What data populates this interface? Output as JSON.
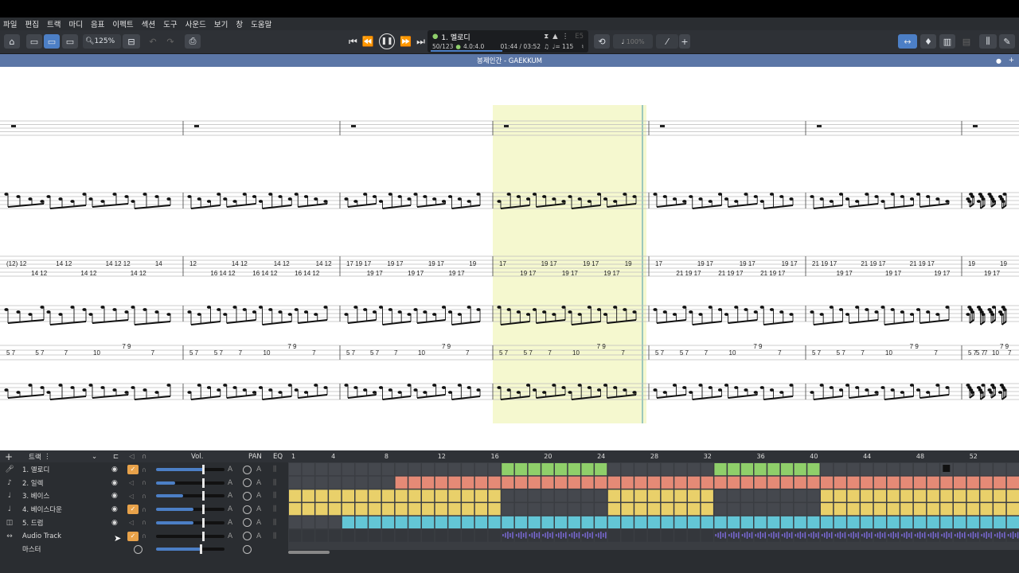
{
  "menu": [
    "파일",
    "편집",
    "트랙",
    "마디",
    "음표",
    "이펙트",
    "섹션",
    "도구",
    "사운드",
    "보기",
    "창",
    "도움말"
  ],
  "toolbar": {
    "zoom_value": "125%",
    "zoom_arrows": "⌃⌄"
  },
  "lcd": {
    "track_name": "1. 멜로디",
    "bar_position": "50/123",
    "time_signature": "4.0:4.0",
    "time": "01:44 / 03:52",
    "tempo": "♩= 115",
    "key": "E5",
    "speed": "100%"
  },
  "score": {
    "title": "봉제인간 - GAEKKUM"
  },
  "mixer": {
    "header_label": "트랙",
    "vol_label": "Vol.",
    "pan_label": "PAN",
    "eq_label": "EQ",
    "auto_label": "A",
    "ruler": [
      "1",
      "4",
      "8",
      "12",
      "16",
      "20",
      "24",
      "28",
      "32",
      "36",
      "40",
      "44",
      "48",
      "52"
    ],
    "tracks": [
      {
        "name": "1. 멜로디",
        "icon": "mic-icon",
        "solo": true,
        "vol": 0.7,
        "color": "#8fcf6a"
      },
      {
        "name": "2. 일렉",
        "icon": "guitar-icon",
        "solo": false,
        "vol": 0.28,
        "color": "#e58a76"
      },
      {
        "name": "3. 베이스",
        "icon": "bass-icon",
        "solo": false,
        "vol": 0.4,
        "color": "#e9d06a"
      },
      {
        "name": "4. 베이스다운",
        "icon": "bass-icon",
        "solo": true,
        "vol": 0.55,
        "color": "#e9d06a"
      },
      {
        "name": "5. 드럼",
        "icon": "drum-icon",
        "solo": false,
        "vol": 0.55,
        "color": "#63c6d6"
      },
      {
        "name": "Audio Track",
        "icon": "audio-icon",
        "solo": true,
        "vol": 0.0,
        "color": "#7a6ad6"
      },
      {
        "name": "마스터",
        "icon": "",
        "solo": false,
        "vol": 0.65,
        "color": ""
      }
    ]
  },
  "tab_numbers": [
    [
      "(12) 12",
      "14 12",
      "14 12",
      "14 12",
      "14 12 12",
      "14 12",
      "14"
    ],
    [
      "12",
      "16 14 12",
      "14 12",
      "16 14 12",
      "14 12",
      "16 14 12",
      "14 12"
    ],
    [
      "17 19 17",
      "19 17",
      "19 17",
      "19 17",
      "19 17",
      "19 17",
      "19"
    ],
    [
      "17",
      "19 17",
      "19 17",
      "19 17",
      "19 17",
      "19 17",
      "19"
    ],
    [
      "17",
      "21 19 17",
      "19 17",
      "21 19 17",
      "19 17",
      "21 19 17",
      "19 17"
    ],
    [
      "21 19 17",
      "19 17",
      "21 19 17",
      "19 17",
      "21 19 17",
      "19 17"
    ],
    [
      "19",
      "19 17",
      "19"
    ]
  ],
  "bass_tab": [
    "5  7",
    "5  7",
    "7",
    "10",
    "7  9",
    "7"
  ]
}
